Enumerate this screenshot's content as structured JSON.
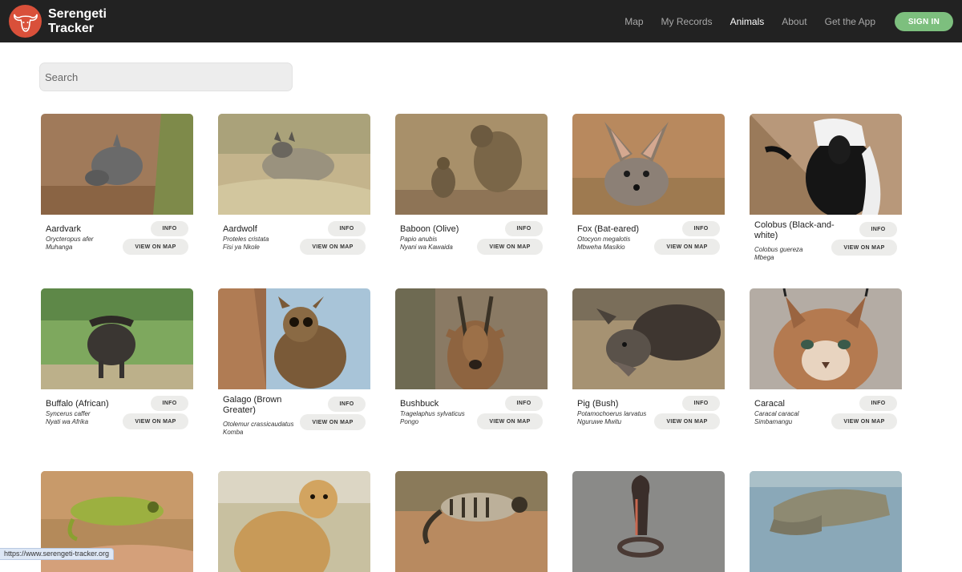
{
  "header": {
    "brand_line1": "Serengeti",
    "brand_line2": "Tracker",
    "nav": [
      "Map",
      "My Records",
      "Animals",
      "About",
      "Get the App"
    ],
    "active_nav": "Animals",
    "sign_in": "SIGN IN",
    "accent": "#7dbf7e",
    "logo_color": "#d9503a"
  },
  "search": {
    "placeholder": "Search"
  },
  "buttons": {
    "info": "INFO",
    "map": "VIEW ON MAP"
  },
  "animals": [
    {
      "name": "Aardvark",
      "sci": "Orycteropus afer",
      "local": "Muhanga",
      "icon": "aardvark-photo"
    },
    {
      "name": "Aardwolf",
      "sci": "Proteles cristata",
      "local": "Fisi ya Nkole",
      "icon": "aardwolf-photo"
    },
    {
      "name": "Baboon (Olive)",
      "sci": "Papio anubis",
      "local": "Nyani wa Kawaida",
      "icon": "baboon-photo"
    },
    {
      "name": "Fox (Bat-eared)",
      "sci": "Otocyon megalotis",
      "local": "Mbweha Masikio",
      "icon": "fox-photo"
    },
    {
      "name": "Colobus (Black-and-white)",
      "sci": "Colobus guereza",
      "local": "Mbega",
      "icon": "colobus-photo"
    },
    {
      "name": "Buffalo (African)",
      "sci": "Syncerus caffer",
      "local": "Nyati wa Afrika",
      "icon": "buffalo-photo"
    },
    {
      "name": "Galago (Brown Greater)",
      "sci": "Otolemur crassicaudatus",
      "local": "Komba",
      "icon": "galago-photo"
    },
    {
      "name": "Bushbuck",
      "sci": "Tragelaphus sylvaticus",
      "local": "Pongo",
      "icon": "bushbuck-photo"
    },
    {
      "name": "Pig (Bush)",
      "sci": "Potamochoerus larvatus",
      "local": "Nguruwe Mwitu",
      "icon": "bushpig-photo"
    },
    {
      "name": "Caracal",
      "sci": "Caracal caracal",
      "local": "Simbamangu",
      "icon": "caracal-photo"
    },
    {
      "name": "",
      "sci": "",
      "local": "",
      "icon": "chameleon-photo"
    },
    {
      "name": "",
      "sci": "",
      "local": "",
      "icon": "cheetah-photo"
    },
    {
      "name": "",
      "sci": "",
      "local": "",
      "icon": "civet-photo"
    },
    {
      "name": "",
      "sci": "",
      "local": "",
      "icon": "cobra-photo"
    },
    {
      "name": "",
      "sci": "",
      "local": "",
      "icon": "crocodile-photo"
    }
  ],
  "status_bar": "https://www.serengeti-tracker.org"
}
